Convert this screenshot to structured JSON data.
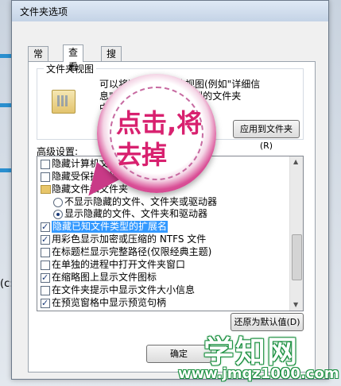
{
  "background": {
    "text": "(c:)"
  },
  "dialog": {
    "title": "文件夹选项",
    "tabs": [
      {
        "label": "常规"
      },
      {
        "label": "查看"
      },
      {
        "label": "搜索"
      }
    ],
    "folder_views": {
      "label": "文件夹视图",
      "desc_lines": [
        "可以将这个文件夹的视图(例如\"详细信",
        "息\")应用到所有这种类型的文件夹",
        "中。"
      ],
      "apply_button": "应用到文件夹(R)"
    },
    "advanced": {
      "label": "高级设置:",
      "items": [
        {
          "kind": "checkbox",
          "checked": false,
          "text": "隐藏计算机文件夹中的空驱动器"
        },
        {
          "kind": "checkbox",
          "checked": false,
          "text": "隐藏受保护的操作系统文件(推荐)"
        },
        {
          "kind": "folder",
          "text": "隐藏文件和文件夹"
        },
        {
          "kind": "radio",
          "checked": false,
          "text": "不显示隐藏的文件、文件夹或驱动器"
        },
        {
          "kind": "radio",
          "checked": true,
          "text": "显示隐藏的文件、文件夹和驱动器"
        },
        {
          "kind": "checkbox",
          "checked": true,
          "text": "隐藏已知文件类型的扩展名",
          "selected": true
        },
        {
          "kind": "checkbox",
          "checked": true,
          "text": "用彩色显示加密或压缩的 NTFS 文件"
        },
        {
          "kind": "checkbox",
          "checked": false,
          "text": "在标题栏显示完整路径(仅限经典主题)"
        },
        {
          "kind": "checkbox",
          "checked": false,
          "text": "在单独的进程中打开文件夹窗口"
        },
        {
          "kind": "checkbox",
          "checked": true,
          "text": "在缩略图上显示文件图标"
        },
        {
          "kind": "checkbox",
          "checked": false,
          "text": "在文件夹提示中显示文件大小信息"
        },
        {
          "kind": "checkbox",
          "checked": true,
          "text": "在预览窗格中显示预览句柄"
        }
      ]
    },
    "restore_button": "还原为默认值(D)",
    "ok_button": "确定"
  },
  "callout": {
    "line1": "点击,将",
    "line2": "去掉"
  },
  "watermark": {
    "brand": "学知网",
    "url": "www.jmqz1000.com"
  },
  "colors": {
    "accent": "#3399ff",
    "callout": "#d8216f",
    "watermark": "#1a8f3f"
  }
}
